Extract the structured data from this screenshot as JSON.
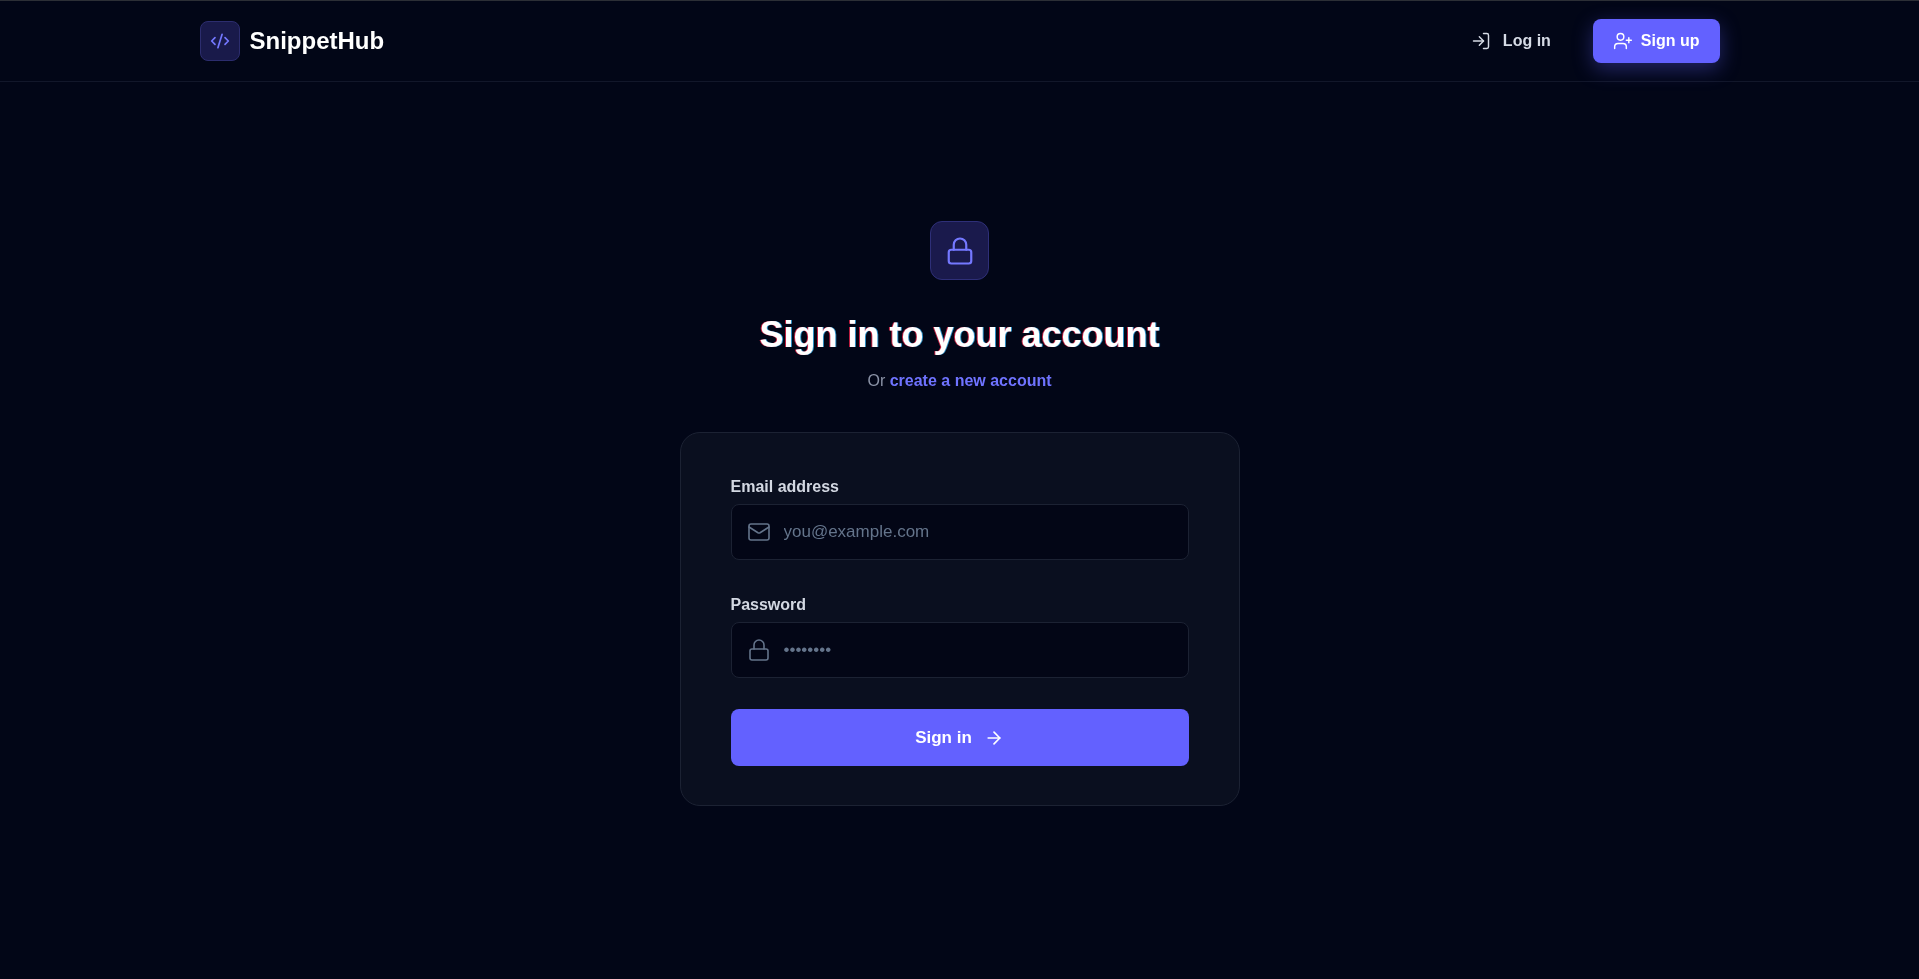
{
  "header": {
    "logo_text": "SnippetHub",
    "nav": [
      {
        "label": "Log in",
        "kind": "link"
      },
      {
        "label": "Sign up",
        "kind": "primary"
      }
    ]
  },
  "heading": {
    "title": "Sign in to your account",
    "subtitle": {
      "prefix": "Or",
      "link": "create a new account"
    }
  },
  "form": {
    "fields": [
      {
        "label": "Email address",
        "placeholder": "you@example.com",
        "kind": "email"
      },
      {
        "label": "Password",
        "placeholder": "••••••••",
        "kind": "password"
      }
    ],
    "submit": "Sign in"
  }
}
